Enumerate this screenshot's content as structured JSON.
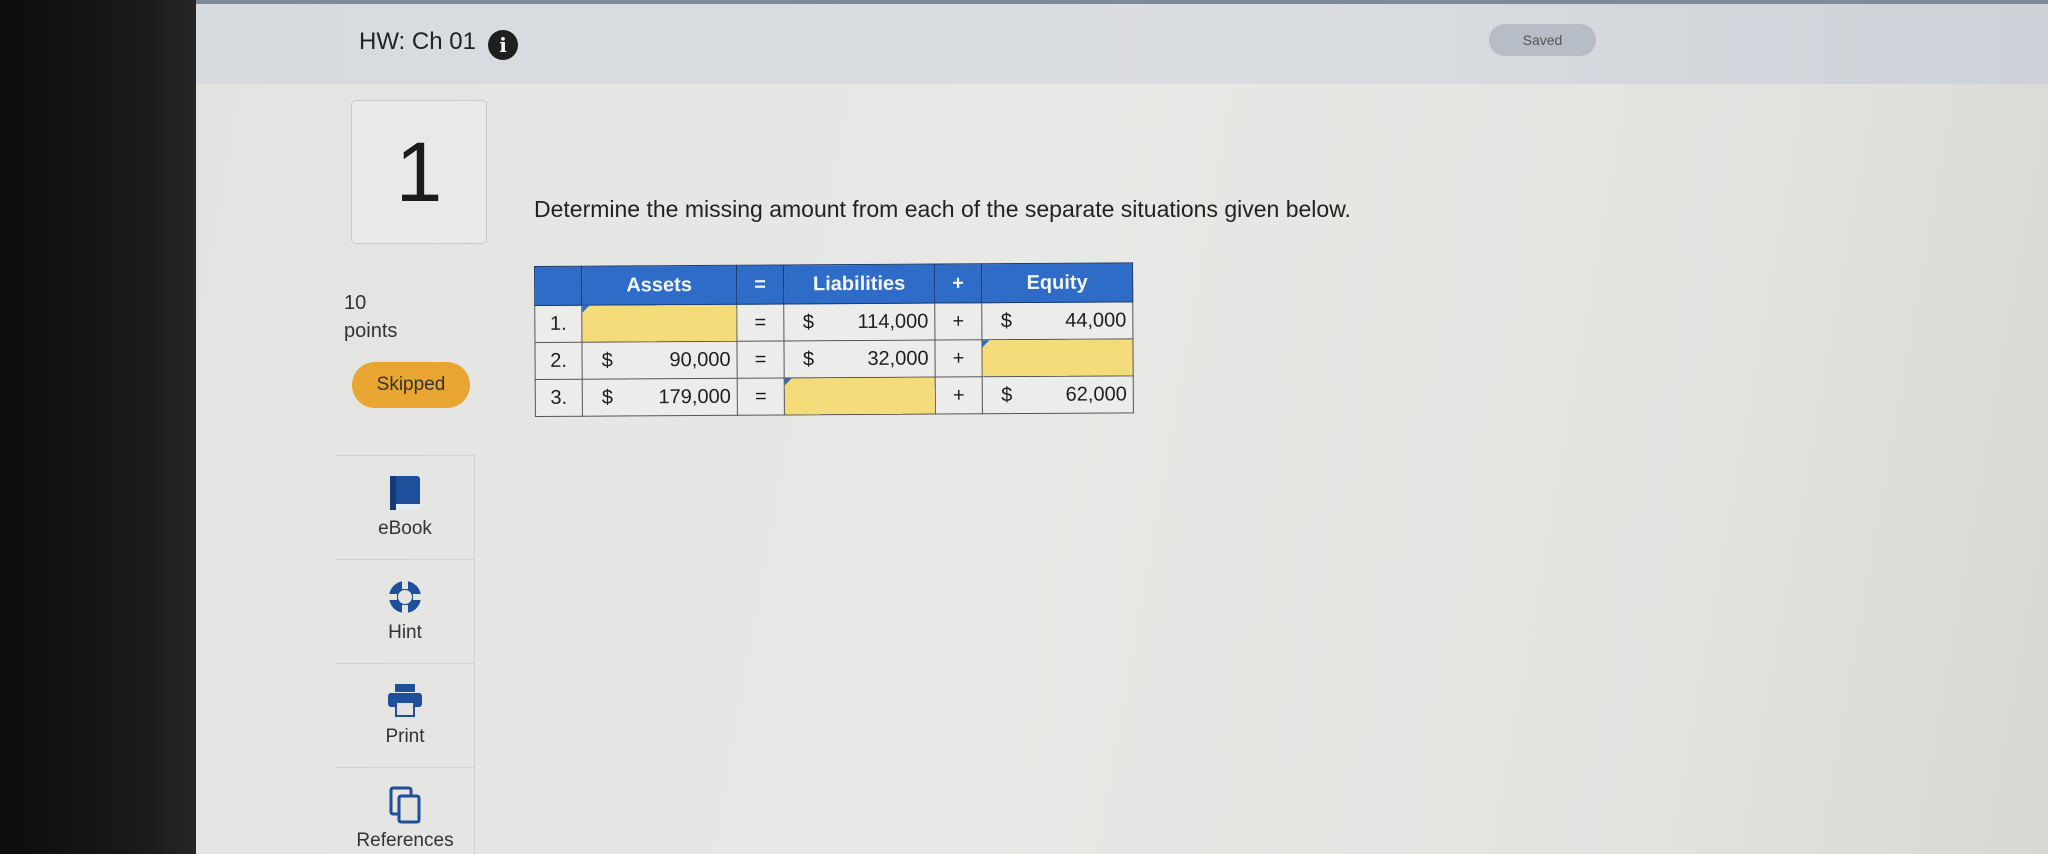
{
  "header": {
    "title": "HW: Ch 01",
    "status": "Saved"
  },
  "question": {
    "number": "1",
    "points_value": "10",
    "points_label": "points",
    "status": "Skipped",
    "prompt": "Determine the missing amount from each of the separate situations given below."
  },
  "tools": [
    {
      "label": "eBook",
      "icon": "book-icon"
    },
    {
      "label": "Hint",
      "icon": "lifebuoy-icon"
    },
    {
      "label": "Print",
      "icon": "printer-icon"
    },
    {
      "label": "References",
      "icon": "copy-pages-icon"
    }
  ],
  "table": {
    "headers": {
      "assets": "Assets",
      "eq": "=",
      "liabilities": "Liabilities",
      "plus": "+",
      "equity": "Equity"
    },
    "rows": [
      {
        "num": "1.",
        "assets_dollar": "",
        "assets": "",
        "eq": "=",
        "liab_dollar": "$",
        "liabilities": "114,000",
        "plus": "+",
        "equity_dollar": "$",
        "equity": "44,000"
      },
      {
        "num": "2.",
        "assets_dollar": "$",
        "assets": "90,000",
        "eq": "=",
        "liab_dollar": "$",
        "liabilities": "32,000",
        "plus": "+",
        "equity_dollar": "",
        "equity": ""
      },
      {
        "num": "3.",
        "assets_dollar": "$",
        "assets": "179,000",
        "eq": "=",
        "liab_dollar": "",
        "liabilities": "",
        "plus": "+",
        "equity_dollar": "$",
        "equity": "62,000"
      }
    ]
  },
  "colors": {
    "header_blue": "#2e6cc8",
    "input_yellow": "#f3dc79",
    "skipped_orange": "#e8a532"
  }
}
